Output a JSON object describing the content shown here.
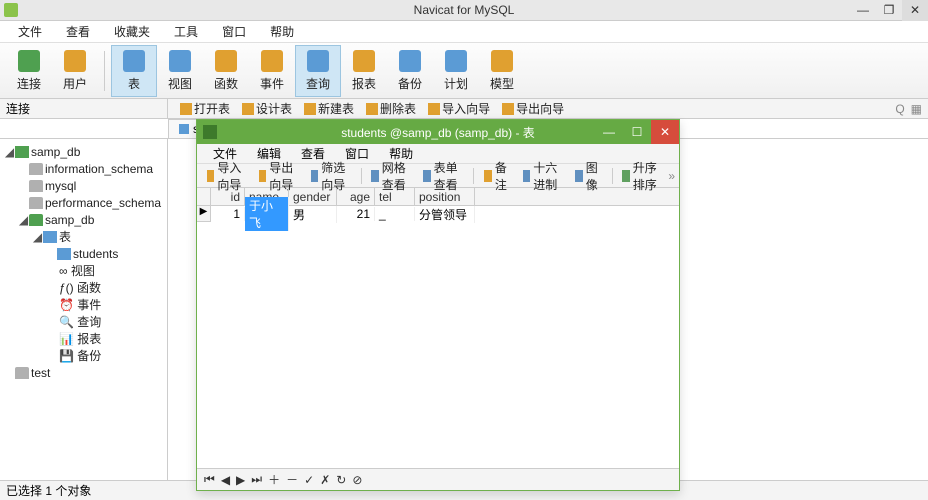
{
  "app": {
    "title": "Navicat for MySQL"
  },
  "menu": {
    "items": [
      "文件",
      "查看",
      "收藏夹",
      "工具",
      "窗口",
      "帮助"
    ]
  },
  "ribbon": {
    "items": [
      {
        "label": "连接",
        "sel": false
      },
      {
        "label": "用户",
        "sel": false
      },
      {
        "sep": true
      },
      {
        "label": "表",
        "sel": true
      },
      {
        "label": "视图",
        "sel": false
      },
      {
        "label": "函数",
        "sel": false
      },
      {
        "label": "事件",
        "sel": false
      },
      {
        "label": "查询",
        "sel": true
      },
      {
        "label": "报表",
        "sel": false
      },
      {
        "label": "备份",
        "sel": false
      },
      {
        "label": "计划",
        "sel": false
      },
      {
        "label": "模型",
        "sel": false
      }
    ]
  },
  "subbar": {
    "panel": "连接",
    "tools": [
      "打开表",
      "设计表",
      "新建表",
      "删除表",
      "导入向导",
      "导出向导"
    ],
    "right": [
      "Q",
      "▦"
    ]
  },
  "tabbar": {
    "label": "students"
  },
  "tree": [
    {
      "d": 0,
      "tw": "◢",
      "ic": "srv",
      "txt": "samp_db"
    },
    {
      "d": 1,
      "tw": "",
      "ic": "db",
      "txt": "information_schema"
    },
    {
      "d": 1,
      "tw": "",
      "ic": "db",
      "txt": "mysql"
    },
    {
      "d": 1,
      "tw": "",
      "ic": "db",
      "txt": "performance_schema"
    },
    {
      "d": 1,
      "tw": "◢",
      "ic": "db act",
      "txt": "samp_db"
    },
    {
      "d": 2,
      "tw": "◢",
      "ic": "tbl",
      "txt": "表"
    },
    {
      "d": 3,
      "tw": "",
      "ic": "tbl",
      "txt": "students"
    },
    {
      "d": 2,
      "tw": "",
      "ic": "fn",
      "txt": "∞ 视图"
    },
    {
      "d": 2,
      "tw": "",
      "ic": "fn",
      "txt": "ƒ() 函数"
    },
    {
      "d": 2,
      "tw": "",
      "ic": "fn",
      "txt": "⏰ 事件"
    },
    {
      "d": 2,
      "tw": "",
      "ic": "fn",
      "txt": "🔍 查询"
    },
    {
      "d": 2,
      "tw": "",
      "ic": "fn",
      "txt": "📊 报表"
    },
    {
      "d": 2,
      "tw": "",
      "ic": "fn",
      "txt": "💾 备份"
    },
    {
      "d": 0,
      "tw": "",
      "ic": "db",
      "txt": "test"
    }
  ],
  "inner": {
    "title": "students @samp_db (samp_db) - 表",
    "menu": [
      "文件",
      "编辑",
      "查看",
      "窗口",
      "帮助"
    ],
    "toolbar": [
      {
        "t": "导入向导",
        "c": "#e0a030"
      },
      {
        "t": "导出向导",
        "c": "#e0a030"
      },
      {
        "t": "筛选向导",
        "c": "#6090c0"
      },
      {
        "sep": true
      },
      {
        "t": "网格查看",
        "c": "#6090c0"
      },
      {
        "t": "表单查看",
        "c": "#6090c0"
      },
      {
        "sep": true
      },
      {
        "t": "备注",
        "c": "#e0a030"
      },
      {
        "t": "十六进制",
        "c": "#6090c0"
      },
      {
        "t": "图像",
        "c": "#6090c0"
      },
      {
        "sep": true
      },
      {
        "t": "升序排序",
        "c": "#60a060"
      }
    ],
    "cols": [
      "id",
      "name",
      "gender",
      "age",
      "tel",
      "position"
    ],
    "row": {
      "id": "1",
      "name": "于小飞",
      "gender": "男",
      "age": "21",
      "tel": "_",
      "position": "分管领导"
    }
  },
  "status": "已选择 1 个对象"
}
